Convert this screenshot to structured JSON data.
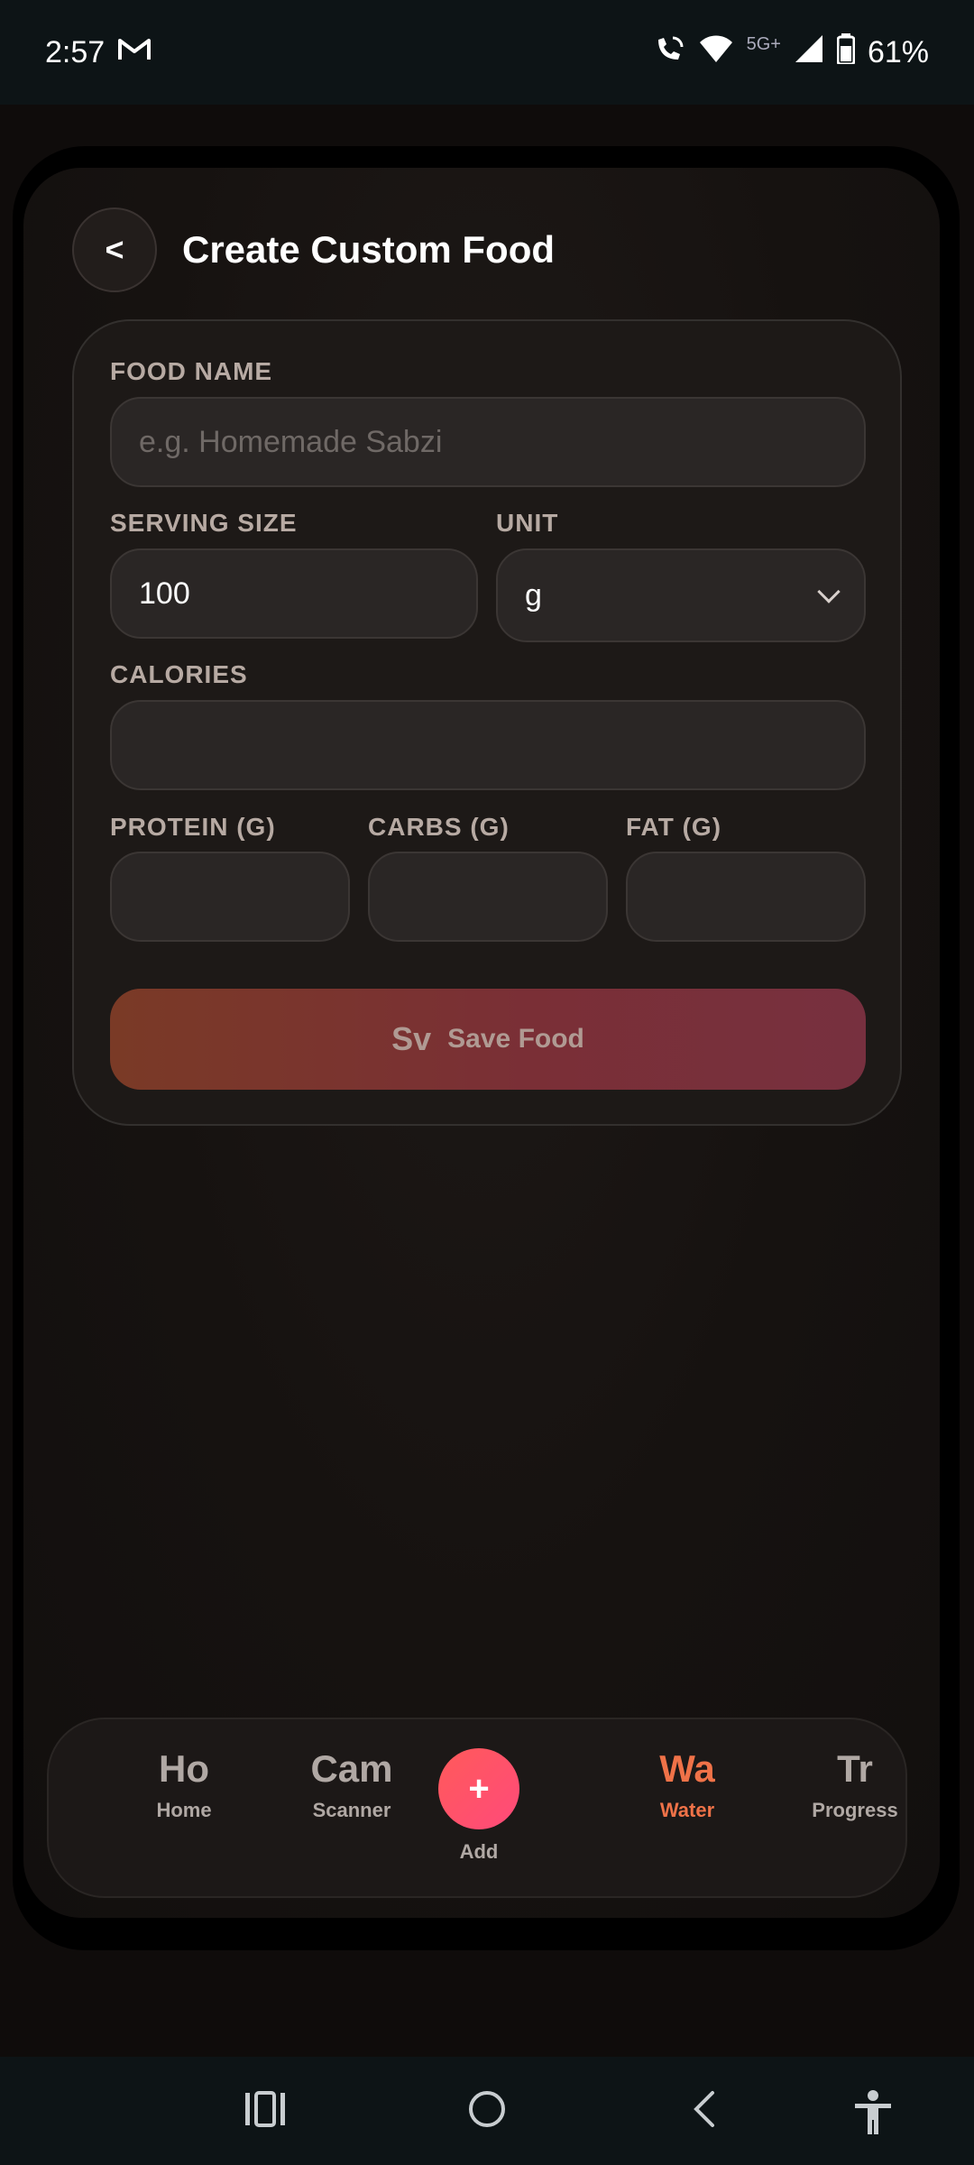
{
  "status_bar": {
    "time": "2:57",
    "network_label": "5G+",
    "battery": "61%",
    "icons": [
      "gmail-icon",
      "wifi-call-icon",
      "wifi-icon",
      "signal-icon",
      "battery-icon"
    ]
  },
  "header": {
    "back_label": "<",
    "title": "Create Custom Food"
  },
  "form": {
    "food_name": {
      "label": "FOOD NAME",
      "value": "",
      "placeholder": "e.g. Homemade Sabzi"
    },
    "serving_size": {
      "label": "SERVING SIZE",
      "value": "100"
    },
    "unit": {
      "label": "UNIT",
      "value": "g"
    },
    "calories": {
      "label": "CALORIES",
      "value": ""
    },
    "protein": {
      "label": "PROTEIN (G)",
      "value": ""
    },
    "carbs": {
      "label": "CARBS (G)",
      "value": ""
    },
    "fat": {
      "label": "FAT (G)",
      "value": ""
    },
    "save": {
      "icon_text": "Sv",
      "label": "Save Food"
    }
  },
  "bottom_nav": {
    "active": "Water",
    "items": [
      {
        "icon_text": "Ho",
        "label": "Home"
      },
      {
        "icon_text": "Cam",
        "label": "Scanner"
      },
      {
        "icon_text": "+",
        "label": "Add"
      },
      {
        "icon_text": "Wa",
        "label": "Water"
      },
      {
        "icon_text": "Tr",
        "label": "Progress"
      }
    ]
  },
  "colors": {
    "accent_orange": "#ef7248",
    "add_button": "#ff4f6d",
    "save_gradient_start": "#7a3a26",
    "save_gradient_end": "#77303f",
    "background": "#0f0c0b",
    "card": "#1d1917"
  },
  "system_nav": {
    "icons": [
      "recent-apps-icon",
      "home-circle-icon",
      "back-chevron-icon",
      "accessibility-icon"
    ]
  }
}
